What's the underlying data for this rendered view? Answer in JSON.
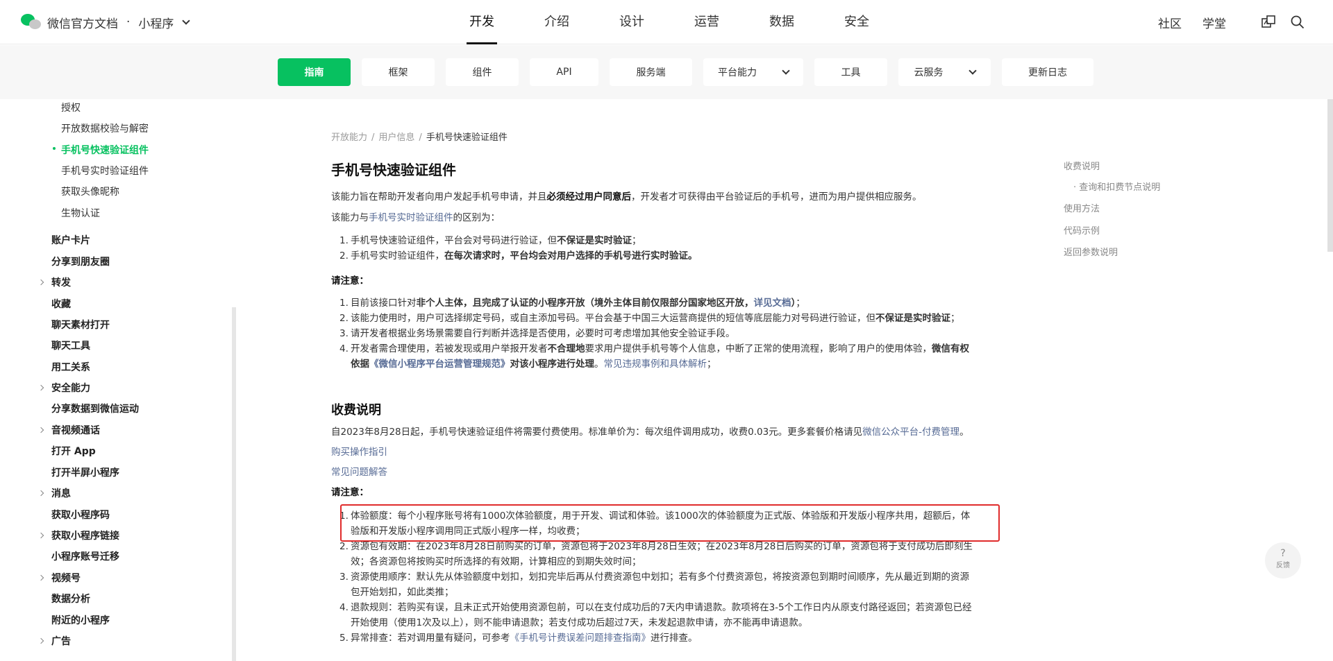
{
  "header": {
    "brand_title": "微信官方文档",
    "brand_sep": "·",
    "product": "小程序",
    "nav": [
      "开发",
      "介绍",
      "设计",
      "运营",
      "数据",
      "安全"
    ],
    "right_links": [
      "社区",
      "学堂"
    ]
  },
  "subnav": {
    "tabs": [
      "指南",
      "框架",
      "组件",
      "API",
      "服务端",
      "平台能力",
      "工具",
      "云服务",
      "更新日志"
    ]
  },
  "sidebar": {
    "items": [
      "授权",
      "开放数据校验与解密",
      "手机号快速验证组件",
      "手机号实时验证组件",
      "获取头像昵称",
      "生物认证",
      "账户卡片",
      "分享到朋友圈",
      "转发",
      "收藏",
      "聊天素材打开",
      "聊天工具",
      "用工关系",
      "安全能力",
      "分享数据到微信运动",
      "音视频通话",
      "打开 App",
      "打开半屏小程序",
      "消息",
      "获取小程序码",
      "获取小程序链接",
      "小程序账号迁移",
      "视频号",
      "数据分析",
      "附近的小程序",
      "广告"
    ]
  },
  "breadcrumb": [
    "开放能力",
    "用户信息",
    "手机号快速验证组件"
  ],
  "title": "手机号快速验证组件",
  "intro": {
    "p1_a": "该能力旨在帮助开发者向用户发起手机号申请，并且",
    "p1_b": "必须经过用户同意后",
    "p1_c": "，开发者才可获得由平台验证后的手机号，进而为用户提供相应服务。",
    "p2_a": "该能力与",
    "p2_link": "手机号实时验证组件",
    "p2_b": "的区别为：",
    "diff1_a": "手机号快速验证组件，平台会对号码进行验证，但",
    "diff1_b": "不保证是实时验证",
    "diff1_c": "；",
    "diff2_a": "手机号实时验证组件，",
    "diff2_b": "在每次请求时，平台均会对用户选择的手机号进行实时验证。",
    "note_label": "请注意：",
    "n1_a": "目前该接口针对",
    "n1_b": "非个人主体，且完成了认证的小程序开放（境外主体目前仅限部分国家地区开放，",
    "n1_link": "详见文档",
    "n1_c": "）",
    "n1_d": "；",
    "n2_a": "该能力使用时，用户可选择绑定号码，或自主添加号码。平台会基于中国三大运营商提供的短信等底层能力对号码进行验证，但",
    "n2_b": "不保证是实时验证",
    "n2_c": "；",
    "n3": "请开发者根据业务场景需要自行判断并选择是否使用，必要时可考虑增加其他安全验证手段。",
    "n4_a": "开发者需合理使用，若被发现或用户举报开发者",
    "n4_b": "不合理地",
    "n4_c": "要求用户提供手机号等个人信息，中断了正常的使用流程，影响了用户的使用体验，",
    "n4_d": "微信有权",
    "n4_e": "依据",
    "n4_link": "《微信小程序平台运营管理规范》",
    "n4_f": "对该小程序进行处理",
    "n4_g": "。",
    "n4_link2": "常见违规事例和具体解析",
    "n4_h": "；"
  },
  "fees": {
    "heading": "收费说明",
    "p_a": "自2023年8月28日起，手机号快速验证组件将需要付费使用。标准单价为：每次组件调用成功，收费0.03元。更多套餐价格请见",
    "p_link": "微信公众平台-付费管理",
    "p_b": "。",
    "link1": "购买操作指引",
    "link2": "常见问题解答",
    "note_label": "请注意：",
    "f1_l1": "体验额度：每个小程序账号将有1000次体验额度，用于开发、调试和体验。该1000次的体验额度为正式版、体验版和开发版小程序共用，超额后，体",
    "f1_l2": "验版和开发版小程序调用同正式版小程序一样，均收费；",
    "f2_l1": "资源包有效期：在2023年8月28日前购买的订单，资源包将于2023年8月28日生效；在2023年8月28日后购买的订单，资源包将于支付成功后即刻生",
    "f2_l2": "效；各资源包将按购买时所选择的有效期，计算相应的到期失效时间；",
    "f3_l1": "资源使用顺序：默认先从体验额度中划扣，划扣完毕后再从付费资源包中划扣；若有多个付费资源包，将按资源包到期时间顺序，先从最近到期的资源",
    "f3_l2": "包开始划扣，如此类推；",
    "f4_l1": "退款规则：若购买有误，且未正式开始使用资源包前，可以在支付成功后的7天内申请退款。款项将在3-5个工作日内从原支付路径返回；若资源包已经",
    "f4_l2": "开始使用（使用1次及以上），则不能申请退款；若支付成功后超过7天，未发起退款申请，亦不能再申请退款。",
    "f5_a": "异常排查：若对调用量有疑问，可参考",
    "f5_link": "《手机号计费误差问题排查指南》",
    "f5_b": "进行排查。"
  },
  "toc": [
    "收费说明",
    "· 查询和扣费节点说明",
    "使用方法",
    "代码示例",
    "返回参数说明"
  ],
  "feedback": {
    "q": "?",
    "label": "反馈"
  },
  "colors": {
    "accent": "#07c160",
    "link": "#576b95",
    "highlight": "#e02b2b"
  }
}
